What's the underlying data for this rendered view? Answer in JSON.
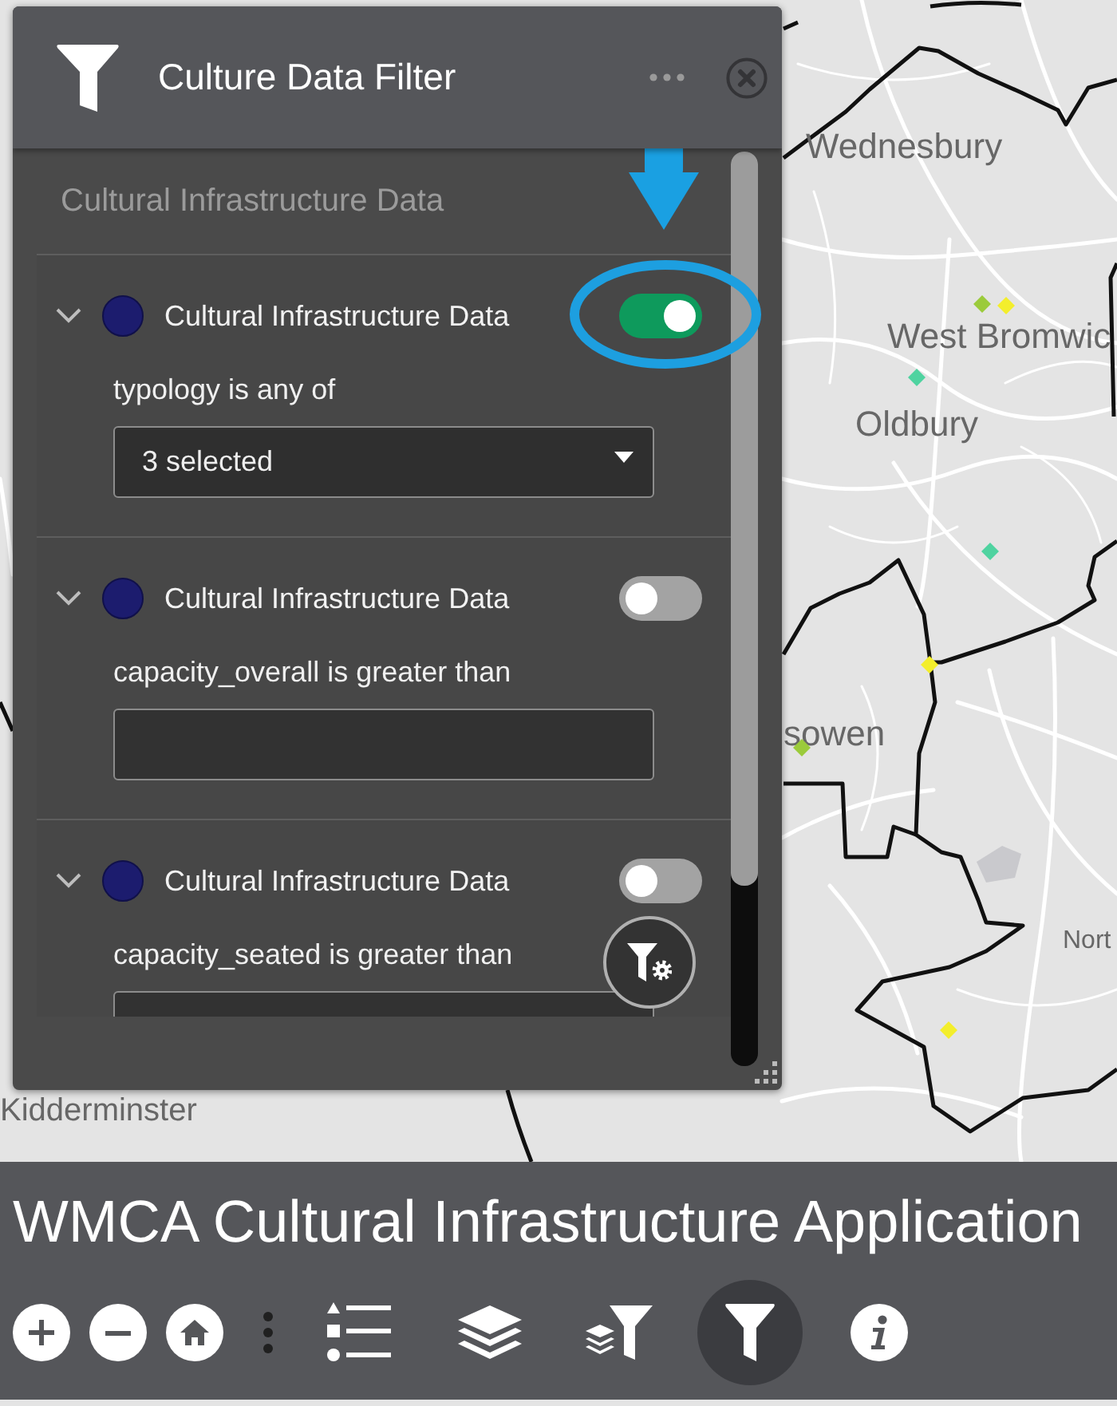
{
  "map": {
    "labels": [
      "Wednesbury",
      "West Bromwic",
      "Oldbury",
      "sowen",
      "Nort",
      "Kidderminster"
    ],
    "markers": [
      {
        "color": "#9bcb3b"
      },
      {
        "color": "#f3ee2c"
      },
      {
        "color": "#4fd3a0"
      },
      {
        "color": "#4fd3a0"
      },
      {
        "color": "#f3ee2c"
      },
      {
        "color": "#9bcb3b"
      },
      {
        "color": "#f3ee2c"
      }
    ]
  },
  "filter_panel": {
    "title": "Culture Data Filter",
    "section_title": "Cultural Infrastructure Data",
    "filters": [
      {
        "layer": "Cultural Infrastructure Data",
        "expanded": true,
        "on": true,
        "condition": "typology is any of",
        "kind": "dropdown",
        "value": "3 selected"
      },
      {
        "layer": "Cultural Infrastructure Data",
        "expanded": true,
        "on": false,
        "condition": "capacity_overall is greater than",
        "kind": "input"
      },
      {
        "layer": "Cultural Infrastructure Data",
        "expanded": true,
        "on": false,
        "condition": "capacity_seated is greater than",
        "kind": "input"
      }
    ]
  },
  "app_bar": {
    "title": "WMCA Cultural Infrastructure Application",
    "widgets": [
      {
        "selected": false
      },
      {
        "selected": false
      },
      {
        "selected": false
      },
      {
        "selected": true
      },
      {
        "selected": false
      }
    ]
  }
}
